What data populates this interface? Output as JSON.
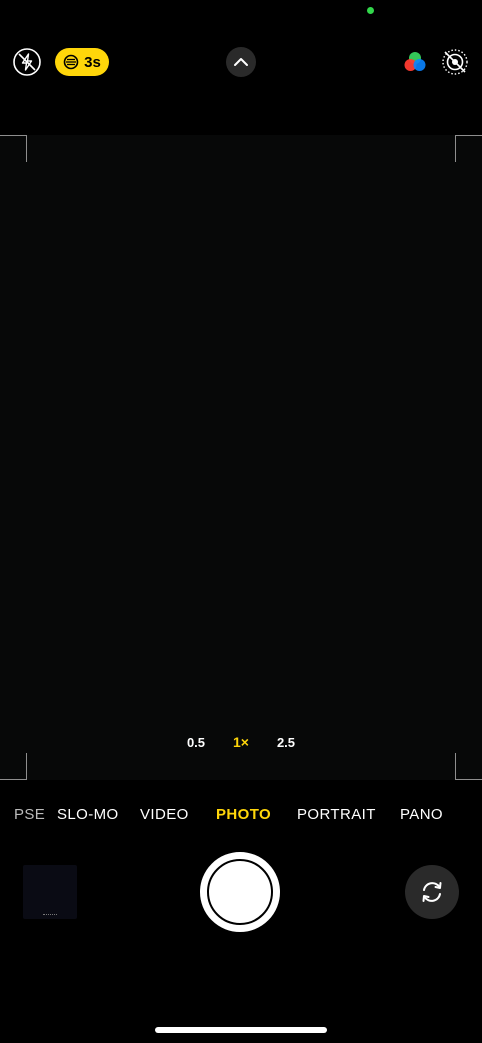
{
  "top_bar": {
    "night_mode_label": "3s"
  },
  "zoom": {
    "levels": [
      "0.5",
      "1×",
      "2.5"
    ],
    "active": "1×"
  },
  "modes": {
    "items": [
      "PSE",
      "SLO-MO",
      "VIDEO",
      "PHOTO",
      "PORTRAIT",
      "PANO"
    ],
    "active": "PHOTO"
  },
  "colors": {
    "accent": "#ffd60a",
    "camera_indicator": "#32d74b",
    "background": "#000000",
    "button_bg": "#2a2a2a"
  },
  "icons": {
    "flash": "flash-off-icon",
    "night": "night-mode-icon",
    "chevron": "chevron-up-icon",
    "styles": "photographic-styles-icon",
    "live": "live-photo-off-icon",
    "flip": "camera-flip-icon"
  }
}
